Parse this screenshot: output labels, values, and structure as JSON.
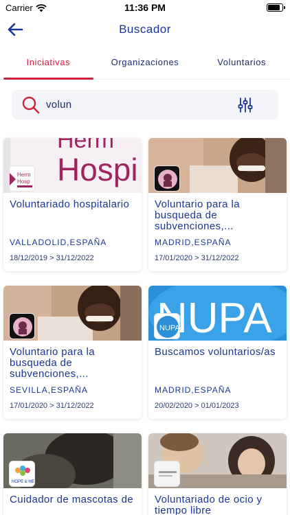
{
  "status_bar": {
    "carrier": "Carrier",
    "time": "11:36 PM"
  },
  "nav": {
    "title": "Buscador"
  },
  "tabs": [
    {
      "label": "Iniciativas",
      "active": true
    },
    {
      "label": "Organizaciones",
      "active": false
    },
    {
      "label": "Voluntarios",
      "active": false
    }
  ],
  "search": {
    "value": "volun"
  },
  "colors": {
    "accent": "#d0233b",
    "primary": "#1a3596",
    "search_bg": "#f2f4f8"
  },
  "cards": [
    {
      "title": "Voluntariado hospitalario",
      "location": "VALLADOLID,ESPAÑA",
      "dates": "18/12/2019 > 31/12/2022",
      "logo_text": "Herm Hosp"
    },
    {
      "title": "Voluntario para la busqueda de subvenciones,...",
      "location": "MADRID,ESPAÑA",
      "dates": "17/01/2020 > 31/12/2022",
      "logo_text": ""
    },
    {
      "title": "Voluntario para la busqueda de subvenciones,...",
      "location": "SEVILLA,ESPAÑA",
      "dates": "17/01/2020 > 31/12/2022",
      "logo_text": ""
    },
    {
      "title": "Buscamos voluntarios/as",
      "location": "MADRID,ESPAÑA",
      "dates": "20/02/2020 > 01/01/2023",
      "logo_text": "NUPA"
    },
    {
      "title": "Cuidador de mascotas de",
      "location": "",
      "dates": "",
      "logo_text": "HOPE & HELP"
    },
    {
      "title": "Voluntariado de ocio y tiempo libre",
      "location": "",
      "dates": "",
      "logo_text": ""
    }
  ],
  "hero_text": {
    "card1": "Herm Hospi",
    "card4": "NUPA"
  }
}
